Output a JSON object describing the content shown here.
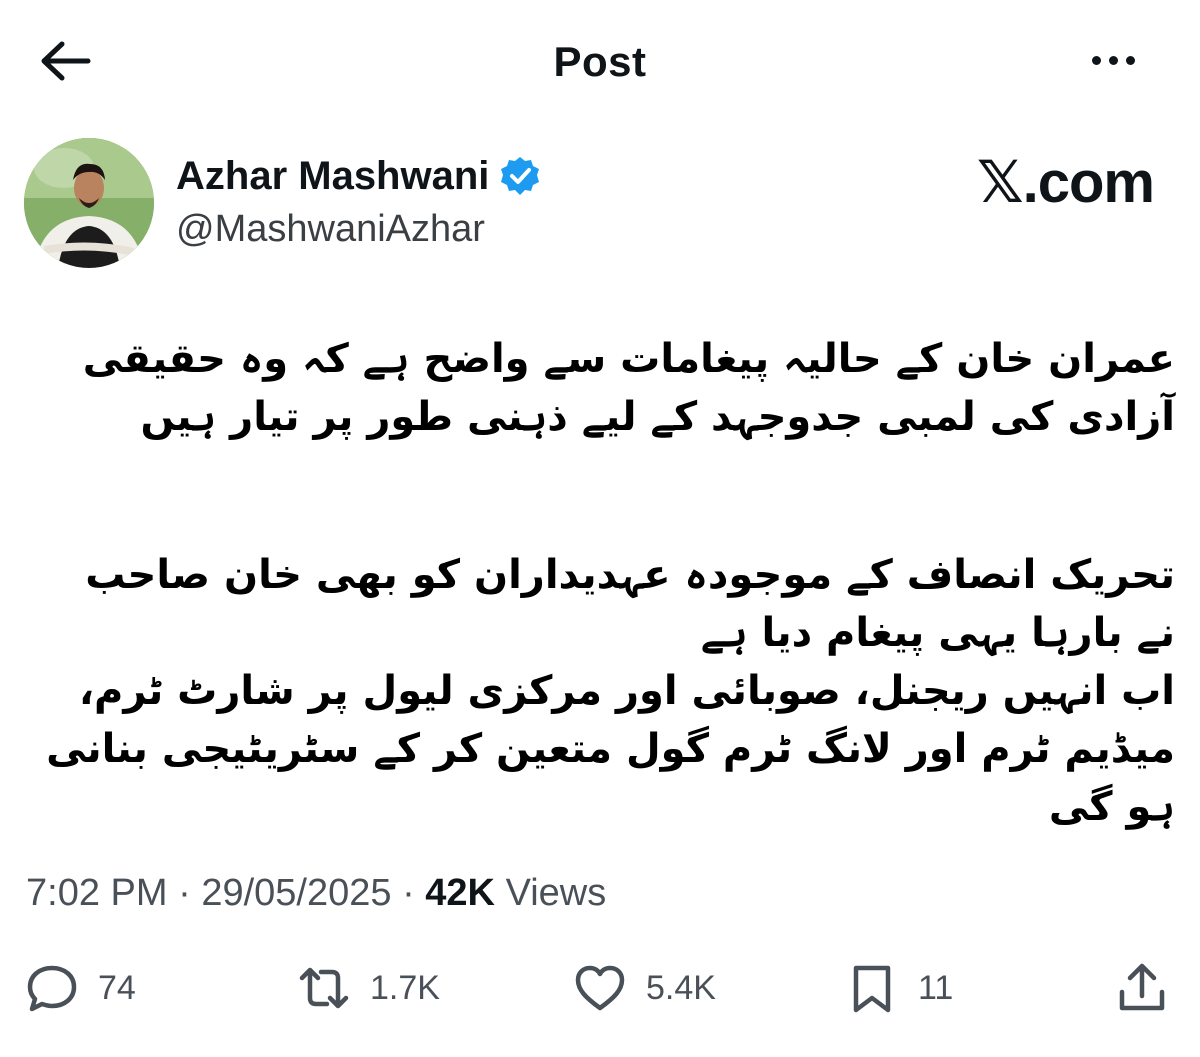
{
  "header": {
    "title": "Post",
    "back_icon": "arrow-left-icon",
    "more_icon": "more-horizontal-icon"
  },
  "author": {
    "name": "Azhar Mashwani",
    "handle": "@MashwaniAzhar",
    "verified_color": "#1d9bf0"
  },
  "watermark": "𝕏.com",
  "tweet": {
    "para1": "عمران خان کے حالیہ پیغامات سے واضح ہے کہ وہ حقیقی آزادی کی لمبی جدوجہد کے لیے ذہنی طور پر تیار ہیں",
    "para2": "تحریک انصاف کے موجودہ عہدیداران کو بھی خان صاحب نے بارہا یہی پیغام دیا ہے",
    "para3": "اب انہیں ریجنل، صوبائی اور مرکزی لیول پر شارٹ ٹرم، میڈیم ٹرم اور لانگ ٹرم گول متعین کر کے سٹریٹیجی بنانی ہو گی"
  },
  "meta": {
    "time": "7:02 PM",
    "date": "29/05/2025",
    "views_count": "42K",
    "views_label": "Views"
  },
  "actions": {
    "replies": "74",
    "reposts": "1.7K",
    "likes": "5.4K",
    "bookmarks": "11"
  }
}
